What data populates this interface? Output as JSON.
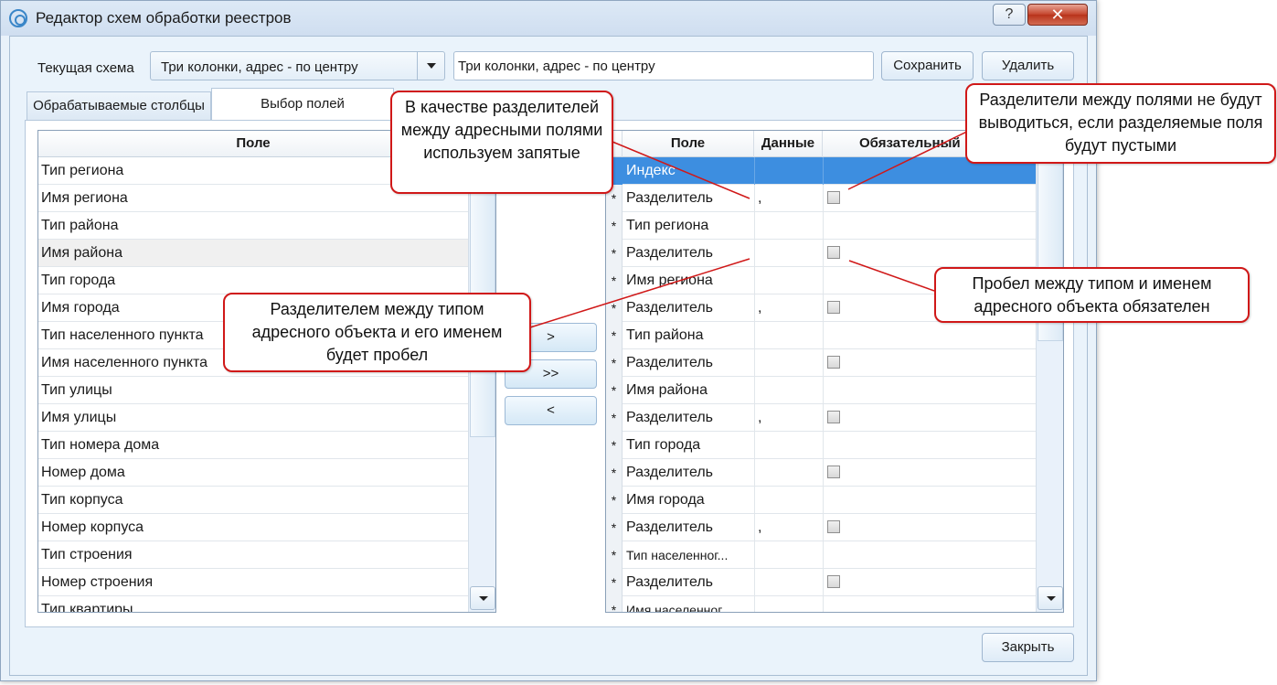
{
  "window": {
    "title": "Редактор схем обработки реестров",
    "help_label": "?",
    "close_label": "✕"
  },
  "scheme": {
    "label": "Текущая схема",
    "selected": "Три колонки, адрес - по центру",
    "name_value": "Три колонки, адрес - по центру",
    "save_label": "Сохранить",
    "delete_label": "Удалить"
  },
  "tabs": [
    {
      "label": "Обрабатываемые столбцы"
    },
    {
      "label": "Выбор полей"
    }
  ],
  "left_list": {
    "header": "Поле",
    "items": [
      "Тип региона",
      "Имя региона",
      "Тип района",
      "Имя района",
      "Тип города",
      "Имя города",
      "Тип населенного пункта",
      "Имя населенного пункта",
      "Тип улицы",
      "Имя улицы",
      "Тип номера дома",
      "Номер дома",
      "Тип корпуса",
      "Номер корпуса",
      "Тип строения",
      "Номер строения",
      "Тип квартиры"
    ]
  },
  "move_buttons": {
    "add": ">",
    "add_all": ">>",
    "remove": "<"
  },
  "right_grid": {
    "headers": {
      "field": "Поле",
      "data": "Данные",
      "required": "Обязательный"
    },
    "rows": [
      {
        "star": "",
        "field": "Индекс",
        "data": "",
        "checkbox": false
      },
      {
        "star": "*",
        "field": "Разделитель",
        "data": ",",
        "checkbox": true
      },
      {
        "star": "*",
        "field": "Тип региона",
        "data": "",
        "checkbox": false
      },
      {
        "star": "*",
        "field": "Разделитель",
        "data": "",
        "checkbox": true
      },
      {
        "star": "*",
        "field": "Имя региона",
        "data": "",
        "checkbox": false
      },
      {
        "star": "*",
        "field": "Разделитель",
        "data": ",",
        "checkbox": true
      },
      {
        "star": "*",
        "field": "Тип района",
        "data": "",
        "checkbox": false
      },
      {
        "star": "*",
        "field": "Разделитель",
        "data": "",
        "checkbox": true
      },
      {
        "star": "*",
        "field": "Имя района",
        "data": "",
        "checkbox": false
      },
      {
        "star": "*",
        "field": "Разделитель",
        "data": ",",
        "checkbox": true
      },
      {
        "star": "*",
        "field": "Тип города",
        "data": "",
        "checkbox": false
      },
      {
        "star": "*",
        "field": "Разделитель",
        "data": "",
        "checkbox": true
      },
      {
        "star": "*",
        "field": "Имя города",
        "data": "",
        "checkbox": false
      },
      {
        "star": "*",
        "field": "Разделитель",
        "data": ",",
        "checkbox": true
      },
      {
        "star": "*",
        "field": "Тип населенног...",
        "data": "",
        "checkbox": false
      },
      {
        "star": "*",
        "field": "Разделитель",
        "data": "",
        "checkbox": true
      },
      {
        "star": "*",
        "field": "Имя населенног...",
        "data": "",
        "checkbox": false
      }
    ]
  },
  "footer": {
    "close_label": "Закрыть"
  },
  "callouts": {
    "commas": "В качестве разделителей между адресными полями используем запятые",
    "not_output": "Разделители между полями не будут выводиться, если разделяемые поля будут пустыми",
    "space_required": "Пробел между типом и именем адресного объекта обязателен",
    "space_separator": "Разделителем между типом адресного объекта и его именем будет пробел"
  },
  "colors": {
    "selection": "#3d8ee0",
    "callout_border": "#d01818",
    "window_bg": "#eaf3fb"
  }
}
